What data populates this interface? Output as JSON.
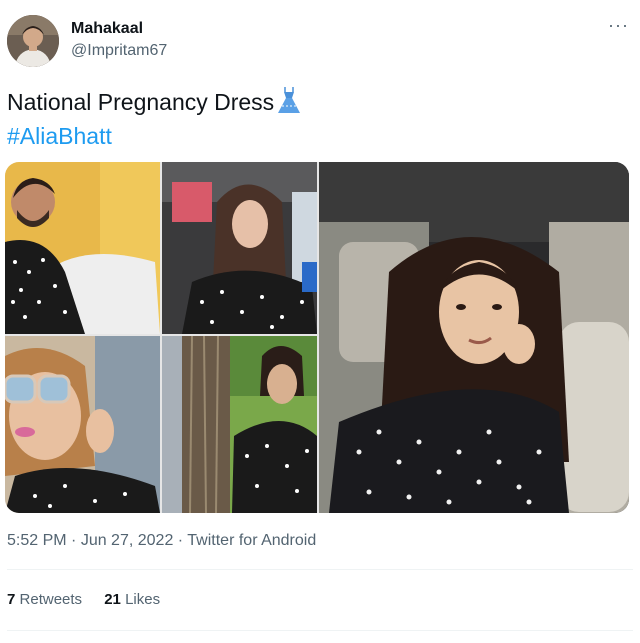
{
  "user": {
    "display_name": "Mahakaal",
    "handle": "@Impritam67"
  },
  "tweet": {
    "text": "National Pregnancy Dress",
    "emoji_icon": "dress-icon",
    "hashtag": "#AliaBhatt"
  },
  "meta": {
    "time": "5:52 PM",
    "separator1": " · ",
    "date": "Jun 27, 2022",
    "separator2": " · ",
    "source": "Twitter for Android"
  },
  "stats": {
    "retweets_count": "7",
    "retweets_label": "Retweets",
    "likes_count": "21",
    "likes_label": "Likes"
  },
  "colors": {
    "hashtag": "#1d9bf0",
    "secondary_text": "#536471",
    "primary_text": "#0f1419"
  }
}
